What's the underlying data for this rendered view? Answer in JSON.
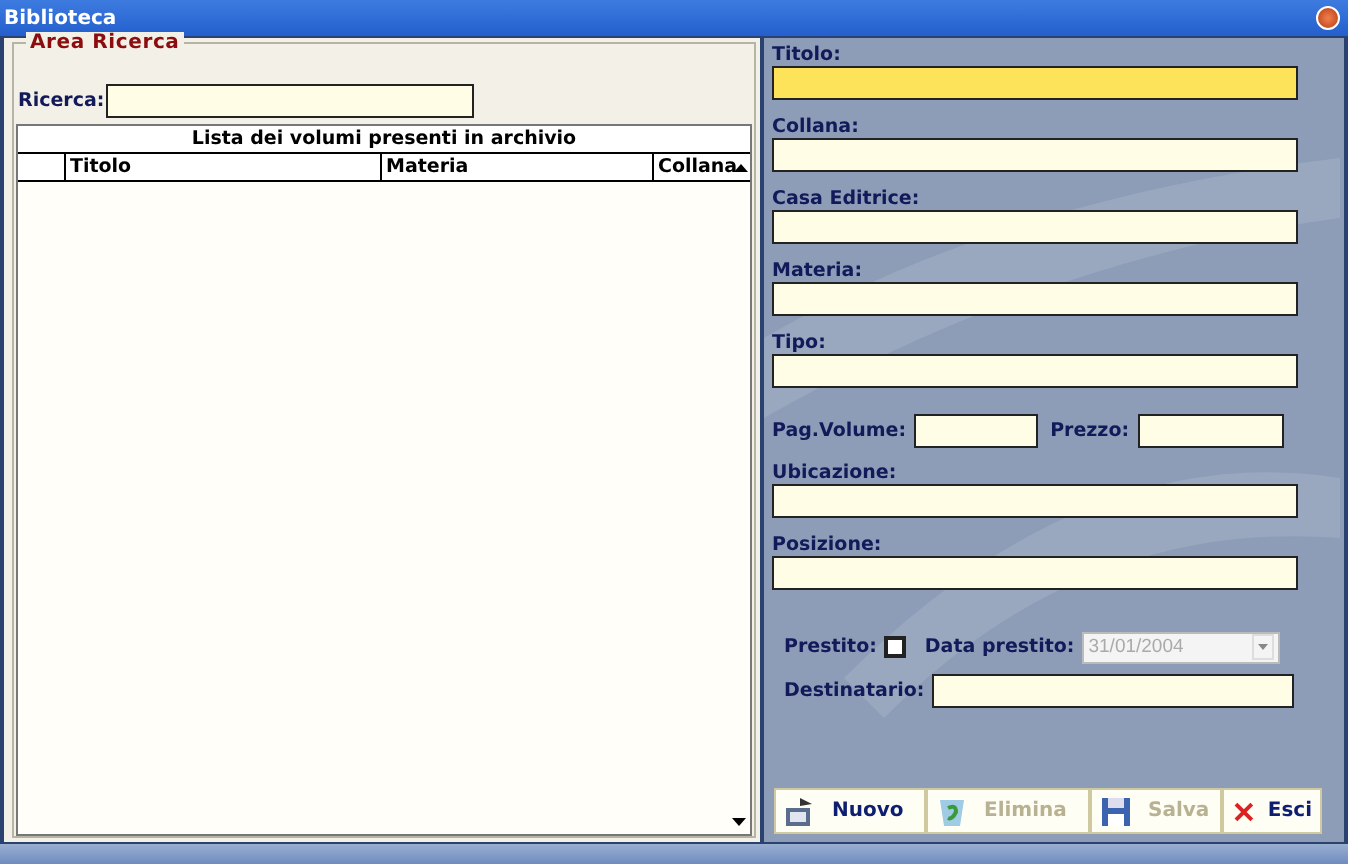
{
  "window": {
    "title": "Biblioteca"
  },
  "search_area": {
    "legend": "Area Ricerca",
    "search_label": "Ricerca:"
  },
  "table": {
    "caption": "Lista dei volumi presenti in archivio",
    "columns": [
      "Titolo",
      "Materia",
      "Collana"
    ]
  },
  "fields_top": [
    {
      "label": "Titolo:",
      "focused": true
    },
    {
      "label": "Collana:",
      "focused": false
    },
    {
      "label": "Casa Editrice:",
      "focused": false
    },
    {
      "label": "Materia:",
      "focused": false
    },
    {
      "label": "Tipo:",
      "focused": false
    }
  ],
  "pair": [
    {
      "label": "Pag.Volume:"
    },
    {
      "label": "Prezzo:"
    }
  ],
  "fields_bottom": [
    {
      "label": "Ubicazione:",
      "focused": false
    },
    {
      "label": "Posizione:",
      "focused": false
    }
  ],
  "loan": {
    "label": "Prestito:",
    "checked": false,
    "date_label": "Data prestito:",
    "date_value": "31/01/2004",
    "date_disabled": true,
    "recipient_label": "Destinatario:"
  },
  "buttons": [
    {
      "label": "Nuovo",
      "kind": "new",
      "disabled": false
    },
    {
      "label": "Elimina",
      "kind": "delete",
      "disabled": true
    },
    {
      "label": "Salva",
      "kind": "save",
      "disabled": true
    },
    {
      "label": "Esci",
      "kind": "exit",
      "disabled": false
    }
  ]
}
